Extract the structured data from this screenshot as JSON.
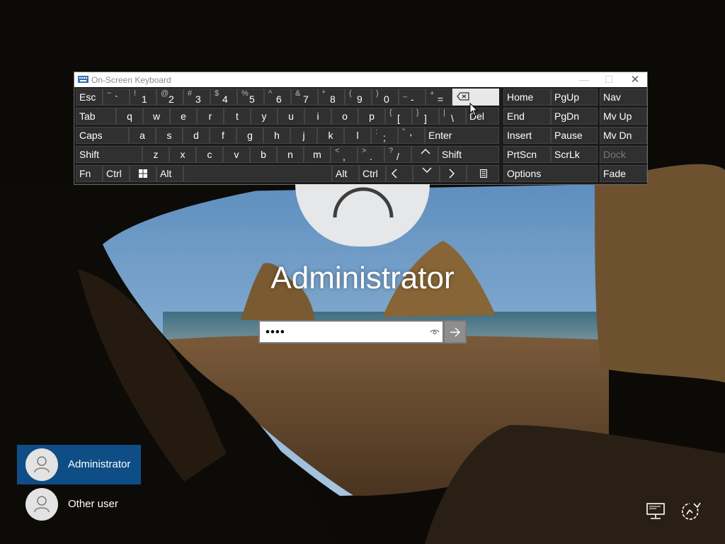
{
  "osk": {
    "title": "On-Screen Keyboard",
    "window_controls": {
      "minimize": "—",
      "maximize": "☐",
      "close": "✕"
    },
    "keys": {
      "esc": "Esc",
      "backtick": {
        "shift": "~",
        "main": "`"
      },
      "k1": {
        "shift": "!",
        "main": "1"
      },
      "k2": {
        "shift": "@",
        "main": "2"
      },
      "k3": {
        "shift": "#",
        "main": "3"
      },
      "k4": {
        "shift": "$",
        "main": "4"
      },
      "k5": {
        "shift": "%",
        "main": "5"
      },
      "k6": {
        "shift": "^",
        "main": "6"
      },
      "k7": {
        "shift": "&",
        "main": "7"
      },
      "k8": {
        "shift": "*",
        "main": "8"
      },
      "k9": {
        "shift": "(",
        "main": "9"
      },
      "k0": {
        "shift": ")",
        "main": "0"
      },
      "minus": {
        "shift": "_",
        "main": "-"
      },
      "equals": {
        "shift": "+",
        "main": "="
      },
      "home": "Home",
      "pgup": "PgUp",
      "nav": "Nav",
      "tab": "Tab",
      "q": "q",
      "w": "w",
      "e": "e",
      "r": "r",
      "t": "t",
      "y": "y",
      "u": "u",
      "i": "i",
      "o": "o",
      "p": "p",
      "lbracket": {
        "shift": "{",
        "main": "["
      },
      "rbracket": {
        "shift": "}",
        "main": "]"
      },
      "backslash": {
        "shift": "|",
        "main": "\\"
      },
      "del": "Del",
      "end": "End",
      "pgdn": "PgDn",
      "mvup": "Mv Up",
      "caps": "Caps",
      "a": "a",
      "s": "s",
      "d": "d",
      "f": "f",
      "g": "g",
      "h": "h",
      "j": "j",
      "k": "k",
      "l": "l",
      "semicolon": {
        "shift": ":",
        "main": ";"
      },
      "quote": {
        "shift": "\"",
        "main": "'"
      },
      "enter": "Enter",
      "insert": "Insert",
      "pause": "Pause",
      "mvdn": "Mv Dn",
      "shift": "Shift",
      "z": "z",
      "x": "x",
      "c": "c",
      "v": "v",
      "b": "b",
      "n": "n",
      "m": "m",
      "comma": {
        "shift": "<",
        "main": ","
      },
      "period": {
        "shift": ">",
        "main": "."
      },
      "slash": {
        "shift": "?",
        "main": "/"
      },
      "up": "^",
      "shift_r": "Shift",
      "prtscn": "PrtScn",
      "scrlk": "ScrLk",
      "dock": "Dock",
      "fn": "Fn",
      "ctrl": "Ctrl",
      "alt": "Alt",
      "alt_r": "Alt",
      "ctrl_r": "Ctrl",
      "left": "<",
      "down": "v",
      "right": ">",
      "options": "Options",
      "fade": "Fade"
    }
  },
  "login": {
    "username": "Administrator",
    "password_masked": "••••",
    "spinner": "loading"
  },
  "users": [
    {
      "name": "Administrator",
      "selected": true
    },
    {
      "name": "Other user",
      "selected": false
    }
  ],
  "icons": {
    "network": "network-icon",
    "accessibility": "ease-of-access-icon",
    "reveal": "eye-icon",
    "submit": "arrow-right-icon",
    "backspace": "backspace-icon"
  },
  "colors": {
    "selected_user": "#0e4d86",
    "key_bg": "#303030",
    "osk_bg": "#1b1b1b"
  }
}
